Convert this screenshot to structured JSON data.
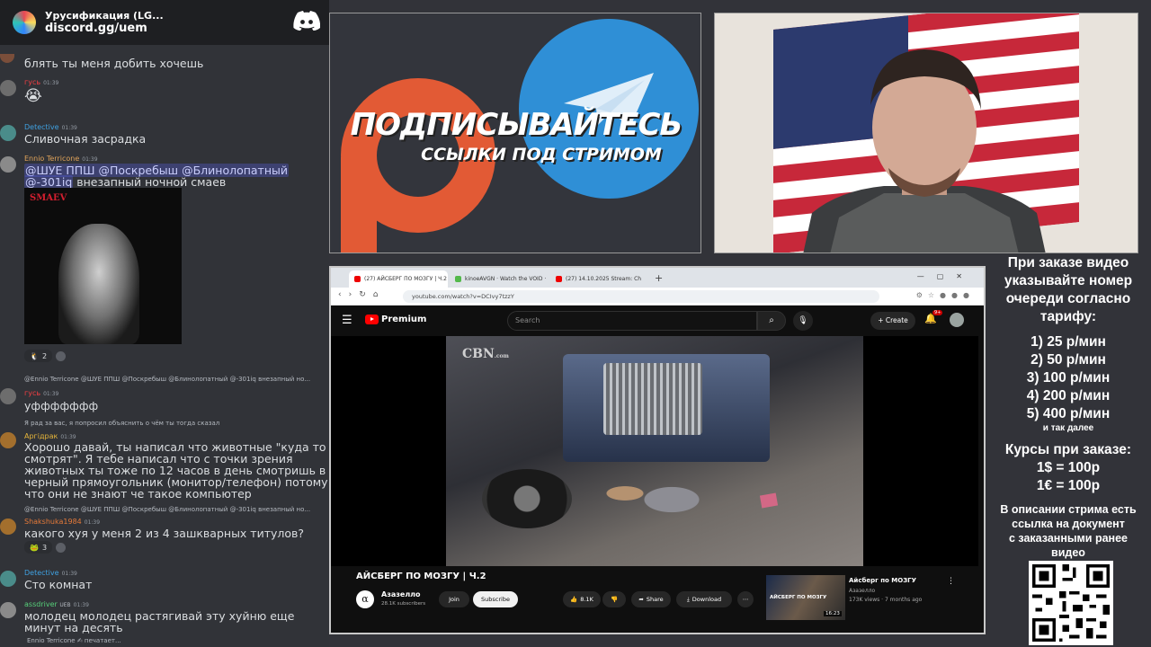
{
  "discord": {
    "server_name": "Урусификация (LG...",
    "invite_link": "discord.gg/uem",
    "messages": [
      {
        "text": "блять ты меня добить хочешь"
      },
      {
        "user": "гусь",
        "time": "01:39",
        "text": "😭"
      },
      {
        "user": "Detective",
        "time": "01:39",
        "text": "Сливочная засрадка"
      },
      {
        "user": "Ennio Terricone",
        "time": "01:39",
        "mentions_line": "@ШУЕ ППШ @Поскребыш @Блинолопатный",
        "mention_2": "@-301iq",
        "text": "внезапный ночной смаев"
      },
      {
        "reaction_count": "2"
      },
      {
        "reply": "@Ennio Terricone @ШУЕ ППШ @Поскребыш @Блинолопатный @-301iq внезапный но...",
        "user": "гусь",
        "time": "01:39",
        "text": "уффффффф"
      },
      {
        "reply": "Я рад за вас, я попросил объяснить о чём ты тогда сказал",
        "user": "Аргiдрак",
        "time": "01:39",
        "text": "Хорошо давай, ты написал что животные \"куда то смотрят\". Я тебе написал что с точки зрения животных ты тоже по 12 часов в день смотришь в черный прямоугольник (монитор/телефон) потому что они не знают че такое компьютер"
      },
      {
        "reply": "@Ennio Terricone @ШУЕ ППШ @Поскребыш @Блинолопатный @-301iq внезапный но...",
        "user": "Shakshuka1984",
        "time": "01:39",
        "text": "какого хуя у меня 2 из 4 зашкварных титулов?",
        "reaction_count": "3"
      },
      {
        "user": "Detective",
        "time": "01:39",
        "text": "Сто комнат"
      },
      {
        "user": "assdriver",
        "user_tag": "UEB",
        "time": "01:39",
        "text": "молодец молодец растягивай эту хуйню еще минут на десять"
      }
    ],
    "image": {
      "logo": "SMAEV"
    },
    "typing": "Ennio Terricone ✍ печатает..."
  },
  "promo": {
    "line1": "ПОДПИСЫВАЙТЕСЬ",
    "line2": "ССЫЛКИ ПОД СТРИМОМ"
  },
  "browser": {
    "tabs": [
      {
        "label": "(27) АЙСБЕРГ ПО МОЗГУ | Ч.2"
      },
      {
        "label": "kinoeAVGN · Watch the VOID ·"
      },
      {
        "label": "(27) 14.10.2025 Stream: Ch"
      }
    ],
    "url": "youtube.com/watch?v=DCIvy7tzzY",
    "yt": {
      "brand": "Premium",
      "search_placeholder": "Search",
      "create": "Create",
      "notif_badge": "9+",
      "video_watermark": "CBN",
      "video_watermark_small": ".com",
      "title": "АЙСБЕРГ ПО МОЗГУ | Ч.2",
      "channel": "Азазелло",
      "subscribers": "28.1K subscribers",
      "join": "Join",
      "subscribe": "Subscribe",
      "likes": "8.1K",
      "share": "Share",
      "download": "Download",
      "reco": {
        "thumb_text": "АЙСБЕРГ ПО МОЗГУ",
        "duration": "16:23",
        "title": "Айсберг по МОЗГУ",
        "channel": "Азазелло",
        "meta": "173K views · 7 months ago"
      }
    }
  },
  "info": {
    "l1": "При заказе видео",
    "l2": "указывайте номер",
    "l3": "очереди согласно",
    "l4": "тарифу:",
    "t1": "1) 25 р/мин",
    "t2": "2) 50 р/мин",
    "t3": "3) 100 р/мин",
    "t4": "4) 200 р/мин",
    "t5": "5) 400 р/мин",
    "etc": "и так далее",
    "c0": "Курсы при заказе:",
    "c1": "1$ = 100р",
    "c2": "1€ = 100р",
    "d1": "В описании стрима есть",
    "d2": "ссылка на документ",
    "d3": "с заказанными ранее",
    "d4": "видео"
  }
}
